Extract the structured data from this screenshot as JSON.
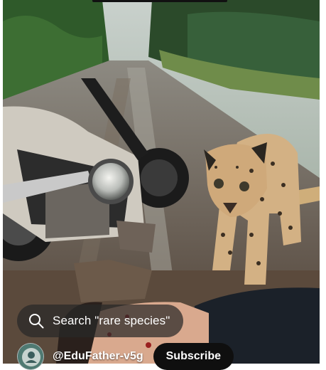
{
  "search": {
    "label": "Search \"rare species\"",
    "icon": "search-icon"
  },
  "channel": {
    "handle": "@EduFather-v5g",
    "avatar_icon": "channel-avatar",
    "subscribe_label": "Subscribe"
  },
  "colors": {
    "search_background": "#282828",
    "subscribe_background": "#0f0f0f",
    "text": "#ffffff"
  }
}
